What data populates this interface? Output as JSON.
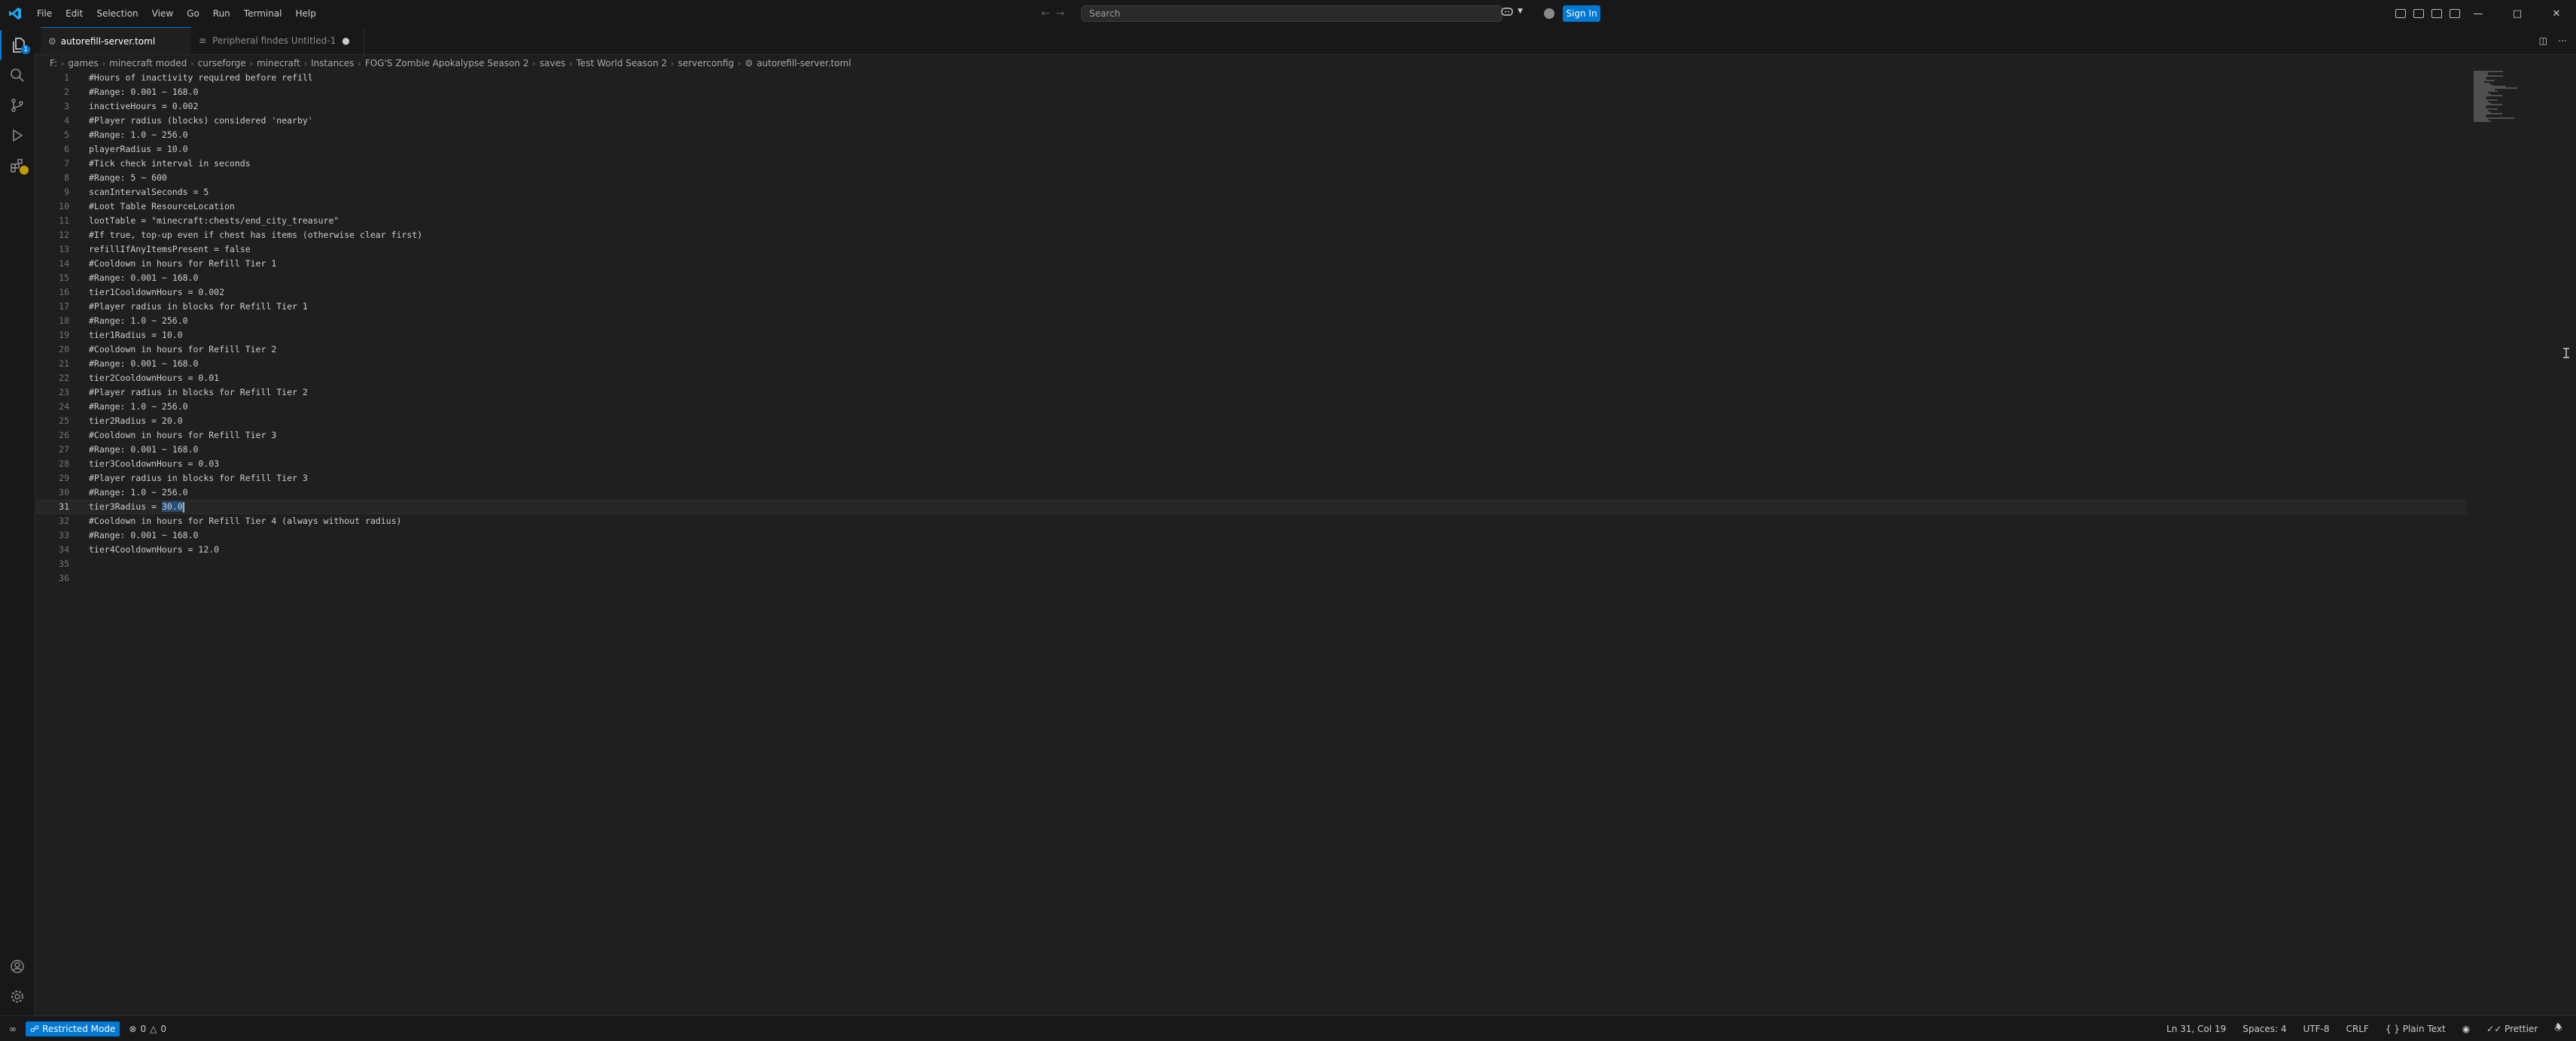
{
  "menu": [
    "File",
    "Edit",
    "Selection",
    "View",
    "Go",
    "Run",
    "Terminal",
    "Help"
  ],
  "search": {
    "placeholder": "Search"
  },
  "signin_label": "Sign In",
  "activity_badges": {
    "explorer": "1"
  },
  "tabs": [
    {
      "label": "autorefill-server.toml",
      "active": true
    },
    {
      "label": "Peripheral findes  Untitled-1",
      "active": false
    }
  ],
  "breadcrumb": [
    "F:",
    "games",
    "minecraft moded",
    "curseforge",
    "minecraft",
    "Instances",
    "FOG'S Zombie Apokalypse Season 2",
    "saves",
    "Test World Season 2",
    "serverconfig",
    "autorefill-server.toml"
  ],
  "editor": {
    "lines": [
      "#Hours of inactivity required before refill",
      "#Range: 0.001 ~ 168.0",
      "inactiveHours = 0.002",
      "#Player radius (blocks) considered 'nearby'",
      "#Range: 1.0 ~ 256.0",
      "playerRadius = 10.0",
      "#Tick check interval in seconds",
      "#Range: 5 ~ 600",
      "scanIntervalSeconds = 5",
      "#Loot Table ResourceLocation",
      "lootTable = \"minecraft:chests/end_city_treasure\"",
      "#If true, top-up even if chest has items (otherwise clear first)",
      "refillIfAnyItemsPresent = false",
      "#Cooldown in hours for Refill Tier 1",
      "#Range: 0.001 ~ 168.0",
      "tier1CooldownHours = 0.002",
      "#Player radius in blocks for Refill Tier 1",
      "#Range: 1.0 ~ 256.0",
      "tier1Radius = 10.0",
      "#Cooldown in hours for Refill Tier 2",
      "#Range: 0.001 ~ 168.0",
      "tier2CooldownHours = 0.01",
      "#Player radius in blocks for Refill Tier 2",
      "#Range: 1.0 ~ 256.0",
      "tier2Radius = 20.0",
      "#Cooldown in hours for Refill Tier 3",
      "#Range: 0.001 ~ 168.0",
      "tier3CooldownHours = 0.03",
      "#Player radius in blocks for Refill Tier 3",
      "#Range: 1.0 ~ 256.0",
      "tier3Radius = 30.0",
      "#Cooldown in hours for Refill Tier 4 (always without radius)",
      "#Range: 0.001 ~ 168.0",
      "tier4CooldownHours = 12.0",
      "",
      ""
    ],
    "current_line": 31,
    "line31_prefix": "tier3Radius = ",
    "line31_selected": "30.0"
  },
  "status": {
    "restricted_mode": "Restricted Mode",
    "errors": "0",
    "warnings": "0",
    "position": "Ln 31, Col 19",
    "spaces": "Spaces: 4",
    "encoding": "UTF-8",
    "eol": "CRLF",
    "language": "Plain Text",
    "formatter": "Prettier"
  },
  "colors": {
    "accent": "#0078d4",
    "background": "#1f1f1f",
    "chrome": "#181818",
    "explorer_badge": "#0078d4",
    "extensions_badge": "#c19c00"
  }
}
